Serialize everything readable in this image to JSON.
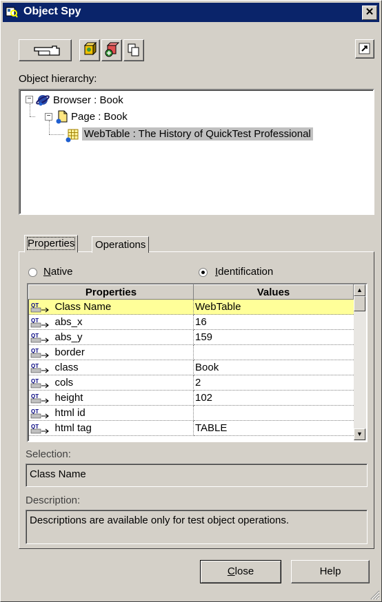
{
  "window": {
    "title": "Object Spy",
    "close_glyph": "✕"
  },
  "toolbar": {
    "pointer_icon": "pointing-hand-icon",
    "buttons": [
      "object-spy-icon",
      "add-object-icon",
      "copy-icon"
    ],
    "pin_icon": "pin-icon"
  },
  "hierarchy": {
    "label": "Object hierarchy:",
    "items": [
      {
        "text": "Browser : Book",
        "icon": "browser-icon",
        "expander": "−"
      },
      {
        "text": "Page : Book",
        "icon": "page-icon",
        "expander": "−"
      },
      {
        "text": "WebTable : The History of QuickTest Professional",
        "icon": "webtable-icon",
        "selected": true
      }
    ]
  },
  "tabs": [
    {
      "label": "Properties",
      "active": true
    },
    {
      "label": "Operations",
      "active": false
    }
  ],
  "radios": {
    "native": {
      "label": "Native",
      "accesskey": "N",
      "rest": "ative",
      "checked": false
    },
    "identification": {
      "label": "Identification",
      "accesskey": "I",
      "rest": "dentification",
      "checked": true
    }
  },
  "grid": {
    "headers": [
      "Properties",
      "Values"
    ],
    "rows": [
      {
        "property": "Class Name",
        "value": "WebTable",
        "selected": true
      },
      {
        "property": "abs_x",
        "value": "16"
      },
      {
        "property": "abs_y",
        "value": "159"
      },
      {
        "property": "border",
        "value": ""
      },
      {
        "property": "class",
        "value": "Book"
      },
      {
        "property": "cols",
        "value": "2"
      },
      {
        "property": "height",
        "value": "102"
      },
      {
        "property": "html id",
        "value": ""
      },
      {
        "property": "html tag",
        "value": "TABLE"
      }
    ]
  },
  "selection": {
    "label": "Selection:",
    "value": "Class Name"
  },
  "description": {
    "label": "Description:",
    "value": "Descriptions are available only for test object operations."
  },
  "buttons": {
    "close": {
      "label": "Close",
      "accesskey": "C",
      "rest": "lose"
    },
    "help": {
      "label": "Help"
    }
  },
  "colors": {
    "titlebar": "#0a246a",
    "selected_row": "#ffff99",
    "selected_tree": "#c0c0c0",
    "face": "#d4d0c8"
  }
}
